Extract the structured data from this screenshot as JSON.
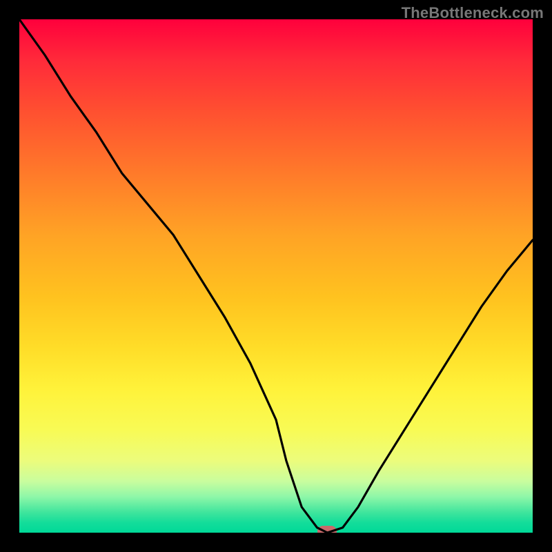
{
  "watermark": "TheBottleneck.com",
  "colors": {
    "frame": "#000000",
    "curve": "#000000",
    "marker": "#c76a6a",
    "text": "#777777"
  },
  "chart_data": {
    "type": "line",
    "title": "",
    "xlabel": "",
    "ylabel": "",
    "xlim": [
      0,
      100
    ],
    "ylim": [
      0,
      100
    ],
    "grid": false,
    "legend": false,
    "background": "rainbow-vertical-gradient",
    "series": [
      {
        "name": "curve",
        "x": [
          0,
          5,
          10,
          15,
          20,
          25,
          30,
          35,
          40,
          45,
          50,
          52,
          55,
          58,
          60,
          63,
          66,
          70,
          75,
          80,
          85,
          90,
          95,
          100
        ],
        "y": [
          100,
          93,
          85,
          78,
          70,
          64,
          58,
          50,
          42,
          33,
          22,
          14,
          5,
          1,
          0,
          1,
          5,
          12,
          20,
          28,
          36,
          44,
          51,
          57
        ]
      }
    ],
    "marker": {
      "x": 60,
      "y": 0
    }
  }
}
